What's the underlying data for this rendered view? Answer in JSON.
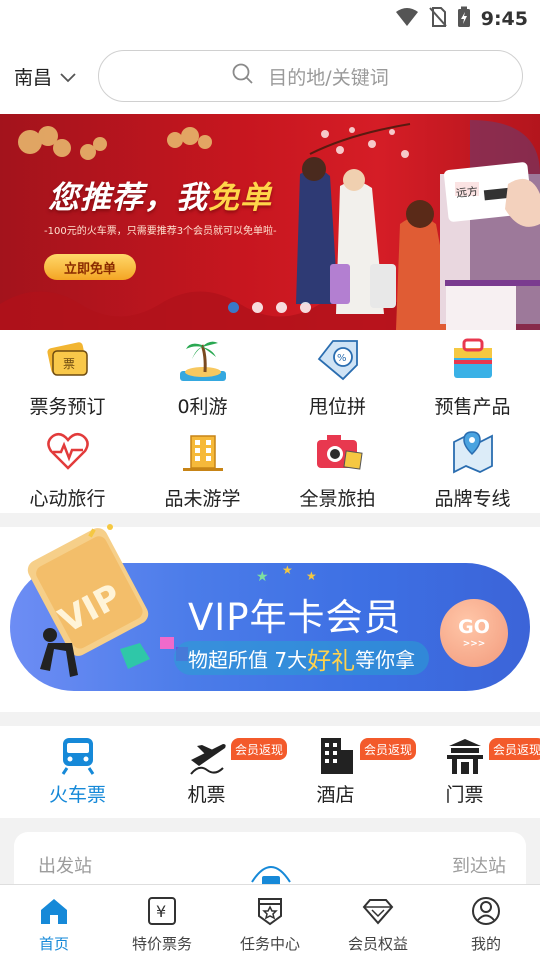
{
  "status_bar": {
    "time": "9:45"
  },
  "header": {
    "city": "南昌",
    "search_placeholder": "目的地/关键词"
  },
  "banner": {
    "title_part1": "您推荐，我",
    "title_highlight": "免单",
    "subtitle": "-100元的火车票，只需要推荐3个会员就可以免单啦-",
    "button": "立即免单",
    "ticket_text": "远方",
    "slides": 4,
    "active_slide": 1
  },
  "quick_grid": [
    {
      "label": "票务预订",
      "icon": "ticket-icon"
    },
    {
      "label": "0利游",
      "icon": "palm-beach-icon"
    },
    {
      "label": "甩位拼",
      "icon": "discount-tag-icon"
    },
    {
      "label": "预售产品",
      "icon": "shopping-bag-icon"
    },
    {
      "label": "心动旅行",
      "icon": "heart-pulse-icon"
    },
    {
      "label": "品未游学",
      "icon": "building-icon"
    },
    {
      "label": "全景旅拍",
      "icon": "camera-icon"
    },
    {
      "label": "品牌专线",
      "icon": "route-map-icon"
    }
  ],
  "vip": {
    "title": "VIP年卡会员",
    "subtitle_pre": "物超所值 7大",
    "subtitle_highlight": "好礼",
    "subtitle_post": "等你拿",
    "go": "GO",
    "go_arrows": ">>>",
    "card_text": "VIP",
    "colors": {
      "gradient_start": "#6d8df4",
      "gradient_end": "#3c64d8",
      "highlight": "#ffd24d"
    }
  },
  "transport_tabs": [
    {
      "label": "火车票",
      "icon": "train-icon",
      "active": true,
      "badge": ""
    },
    {
      "label": "机票",
      "icon": "airplane-icon",
      "active": false,
      "badge": "会员返现"
    },
    {
      "label": "酒店",
      "icon": "hotel-icon",
      "active": false,
      "badge": "会员返现"
    },
    {
      "label": "门票",
      "icon": "gate-icon",
      "active": false,
      "badge": "会员返现"
    }
  ],
  "booking": {
    "departure_label": "出发站",
    "arrival_label": "到达站"
  },
  "bottom_nav": [
    {
      "label": "首页",
      "icon": "home-icon",
      "active": true
    },
    {
      "label": "特价票务",
      "icon": "yen-icon",
      "active": false
    },
    {
      "label": "任务中心",
      "icon": "task-badge-icon",
      "active": false
    },
    {
      "label": "会员权益",
      "icon": "diamond-icon",
      "active": false
    },
    {
      "label": "我的",
      "icon": "user-icon",
      "active": false
    }
  ],
  "colors": {
    "accent": "#1689d8",
    "badge": "#f35a2b",
    "banner_red": "#c7161f"
  }
}
